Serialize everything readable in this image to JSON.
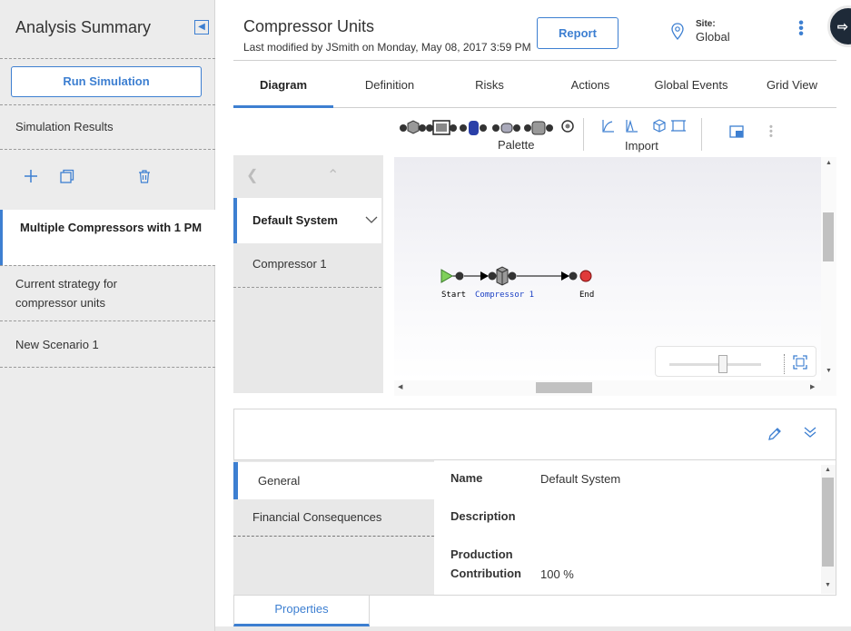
{
  "sidebar": {
    "title": "Analysis Summary",
    "run_button": "Run Simulation",
    "results_label": "Simulation Results",
    "scenarios": [
      {
        "label": "Multiple Compressors with 1 PM",
        "active": true
      },
      {
        "label": "Current strategy for compressor units",
        "active": false
      },
      {
        "label": "New Scenario 1",
        "active": false
      }
    ]
  },
  "header": {
    "title": "Compressor Units",
    "subtitle": "Last modified by JSmith on Monday, May 08, 2017 3:59 PM",
    "report_button": "Report",
    "site_label": "Site:",
    "site_value": "Global"
  },
  "tabs": [
    "Diagram",
    "Definition",
    "Risks",
    "Actions",
    "Global Events",
    "Grid View"
  ],
  "active_tab": "Diagram",
  "toolbar": {
    "palette_label": "Palette",
    "import_label": "Import"
  },
  "systems": [
    {
      "label": "Default System",
      "active": true
    },
    {
      "label": "Compressor 1",
      "active": false
    }
  ],
  "diagram": {
    "start_label": "Start",
    "element_label": "Compressor 1",
    "end_label": "End",
    "zoom_level": 0.5
  },
  "details": {
    "tabs": [
      "General",
      "Financial Consequences"
    ],
    "fields": [
      {
        "label": "Name",
        "value": "Default System"
      },
      {
        "label": "Description",
        "value": ""
      },
      {
        "label": "Production Contribution",
        "value": "100 %"
      }
    ],
    "bottom_tab": "Properties"
  },
  "colors": {
    "accent": "#3d7fd1",
    "start_node": "#7fd05a",
    "end_node": "#e03a3a"
  }
}
